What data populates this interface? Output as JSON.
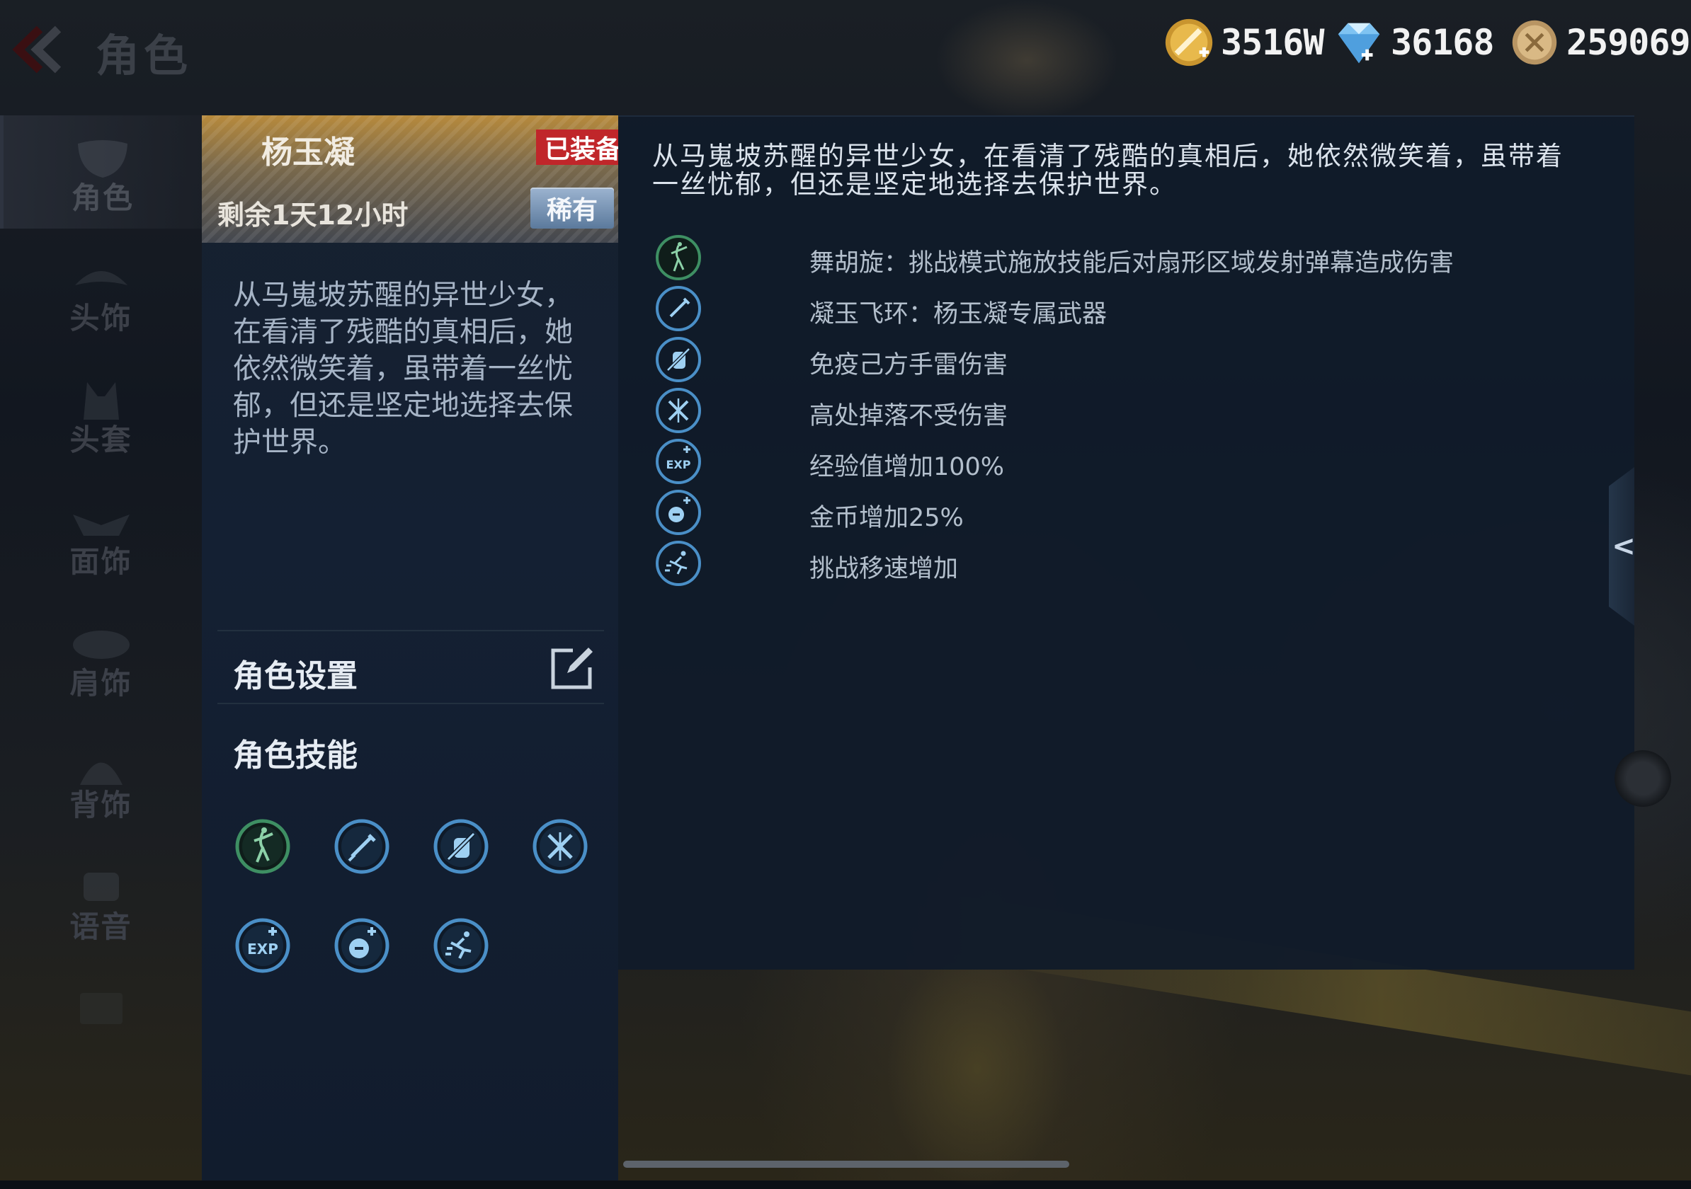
{
  "header": {
    "title": "角色",
    "back_icon": "back-chevron-icon"
  },
  "currencies": [
    {
      "name": "gold-coupon",
      "icon": "gold-coupon-icon",
      "value": "3516W"
    },
    {
      "name": "diamond",
      "icon": "diamond-icon",
      "value": "36168"
    },
    {
      "name": "coin",
      "icon": "coin-icon",
      "value": "259069"
    }
  ],
  "sidebar": {
    "items": [
      {
        "label": "角色",
        "icon": "mask-icon",
        "active": true
      },
      {
        "label": "头饰",
        "icon": "headwear-icon",
        "active": false
      },
      {
        "label": "头套",
        "icon": "headgear-icon",
        "active": false
      },
      {
        "label": "面饰",
        "icon": "face-accessory-icon",
        "active": false
      },
      {
        "label": "肩饰",
        "icon": "shoulder-accessory-icon",
        "active": false
      },
      {
        "label": "背饰",
        "icon": "back-accessory-icon",
        "active": false
      },
      {
        "label": "语音",
        "icon": "voice-icon",
        "active": false
      }
    ]
  },
  "character": {
    "name": "杨玉凝",
    "equipped_label": "已装备",
    "time_left": "剩余1天12小时",
    "rarity": "稀有",
    "short_description": "从马嵬坡苏醒的异世少女，在看清了残酷的真相后，她依然微笑着，虽带着一丝忧郁，但还是坚定地选择去保护世界。",
    "settings_label": "角色设置",
    "skills_title": "角色技能"
  },
  "details": {
    "description": "从马嵬坡苏醒的异世少女，在看清了残酷的真相后，她依然微笑着，虽带着一丝忧郁，但还是坚定地选择去保护世界。",
    "abilities": [
      {
        "icon": "dancer-icon",
        "text": "舞胡旋：挑战模式施放技能后对扇形区域发射弹幕造成伤害",
        "color": "#3e8f63"
      },
      {
        "icon": "weapon-icon",
        "text": "凝玉飞环：杨玉凝专属武器",
        "color": "#4a8fc7"
      },
      {
        "icon": "grenade-immune-icon",
        "text": "免疫己方手雷伤害",
        "color": "#4a8fc7"
      },
      {
        "icon": "fall-immune-icon",
        "text": "高处掉落不受伤害",
        "color": "#4a8fc7"
      },
      {
        "icon": "exp-boost-icon",
        "text": "经验值增加100%",
        "color": "#4a8fc7"
      },
      {
        "icon": "coin-boost-icon",
        "text": "金币增加25%",
        "color": "#4a8fc7"
      },
      {
        "icon": "speed-boost-icon",
        "text": "挑战移速增加",
        "color": "#4a8fc7"
      }
    ]
  },
  "side_toggle": {
    "icon": "collapse-chevron-icon",
    "label": "<"
  }
}
